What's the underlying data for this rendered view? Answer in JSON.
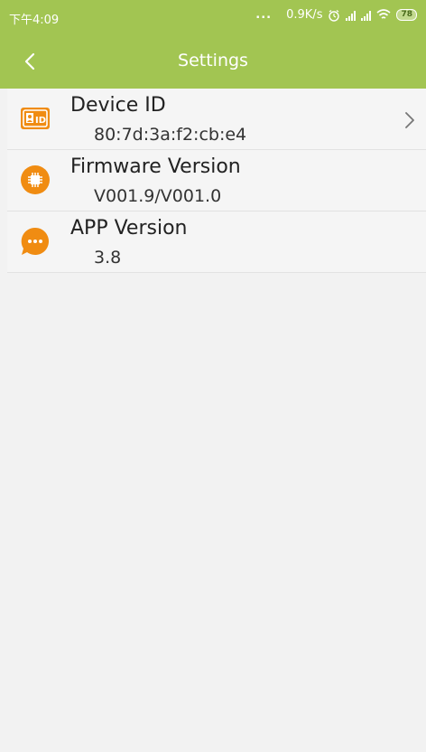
{
  "status_bar": {
    "time": "下午4:09",
    "dots": "...",
    "network_speed": "0.9K/s",
    "battery_level": "78"
  },
  "toolbar": {
    "title": "Settings",
    "back_icon": "chevron-left-icon"
  },
  "settings": [
    {
      "title": "Device ID",
      "value": "80:7d:3a:f2:cb:e4",
      "icon": "id-card-icon"
    },
    {
      "title": "Firmware Version",
      "value": "V001.9/V001.0",
      "icon": "chip-icon"
    },
    {
      "title": "APP Version",
      "value": "3.8",
      "icon": "chat-bubble-icon"
    }
  ],
  "colors": {
    "header": "#a2c552",
    "icon_accent": "#f08c12",
    "background": "#f2f2f2"
  }
}
